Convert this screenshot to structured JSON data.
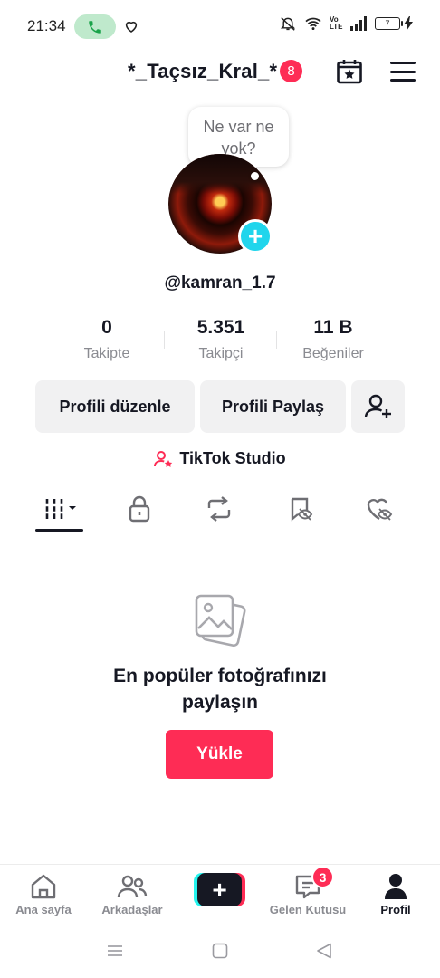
{
  "status_bar": {
    "time": "21:34",
    "network": "Vo LTE",
    "battery": "7"
  },
  "header": {
    "username": "*_Taçsız_Kral_*",
    "notification_count": "8"
  },
  "note": {
    "text_line1": "Ne var ne",
    "text_line2": "yok?"
  },
  "profile": {
    "handle": "@kamran_1.7"
  },
  "stats": [
    {
      "value": "0",
      "label": "Takipte"
    },
    {
      "value": "5.351",
      "label": "Takipçi"
    },
    {
      "value": "11 B",
      "label": "Beğeniler"
    }
  ],
  "buttons": {
    "edit_profile": "Profili düzenle",
    "share_profile": "Profili Paylaş"
  },
  "studio": {
    "label": "TikTok Studio"
  },
  "tabs": [
    "videos-grid-icon",
    "lock-icon",
    "repost-icon",
    "favorites-icon",
    "liked-icon"
  ],
  "empty_state": {
    "line1": "En popüler fotoğrafınızı",
    "line2": "paylaşın",
    "upload_label": "Yükle"
  },
  "bottom_nav": {
    "home": "Ana sayfa",
    "friends": "Arkadaşlar",
    "inbox": "Gelen Kutusu",
    "inbox_count": "3",
    "profile": "Profil"
  },
  "colors": {
    "accent": "#fe2c55",
    "cyan": "#25f4ee",
    "text": "#161823",
    "muted": "#8a8b91"
  }
}
